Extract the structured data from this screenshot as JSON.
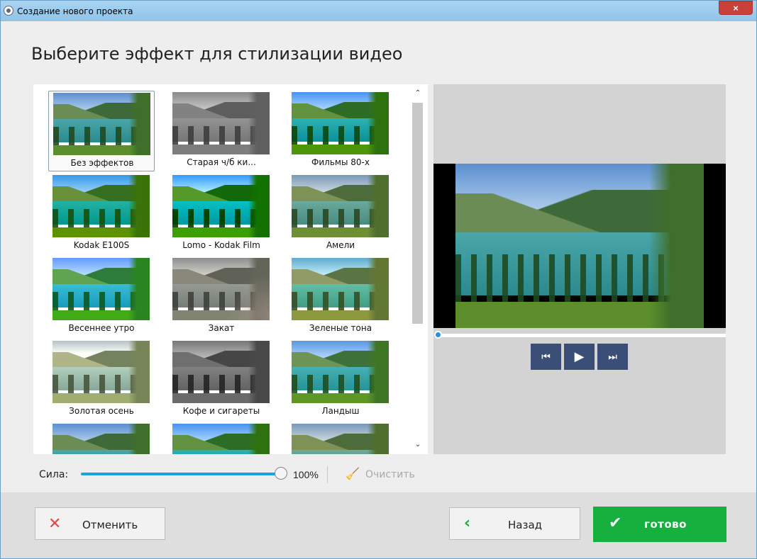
{
  "window": {
    "title": "Создание нового проекта",
    "close_icon": "×"
  },
  "heading": "Выберите эффект для стилизации видео",
  "effects": [
    {
      "label": "Без эффектов",
      "selected": true
    },
    {
      "label": "Старая ч/б ки..."
    },
    {
      "label": "Фильмы 80-х"
    },
    {
      "label": "Kodak E100S"
    },
    {
      "label": "Lomo - Kodak Film"
    },
    {
      "label": "Амели"
    },
    {
      "label": "Весеннее утро"
    },
    {
      "label": "Закат"
    },
    {
      "label": "Зеленые тона"
    },
    {
      "label": "Золотая осень"
    },
    {
      "label": "Кофе и сигареты"
    },
    {
      "label": "Ландыш"
    },
    {
      "label": ""
    },
    {
      "label": ""
    },
    {
      "label": ""
    }
  ],
  "scroll": {
    "up_icon": "⌃",
    "down_icon": "⌄"
  },
  "player": {
    "prev_icon": "⏮",
    "play_icon": "▶",
    "next_icon": "⏭",
    "progress": 0
  },
  "strength": {
    "label": "Сила:",
    "value_text": "100%",
    "value": 1.0
  },
  "clear": {
    "icon": "🧹",
    "label": "Очистить"
  },
  "buttons": {
    "cancel": {
      "icon": "✕",
      "label": "Отменить"
    },
    "back": {
      "icon": "‹",
      "label": "Назад"
    },
    "done": {
      "icon": "✔",
      "label": "готово"
    }
  },
  "colors": {
    "accent_blue": "#19a3e0",
    "done_green": "#15b03e",
    "player_ctrl": "#3a4e78",
    "cancel_red": "#e04848"
  }
}
